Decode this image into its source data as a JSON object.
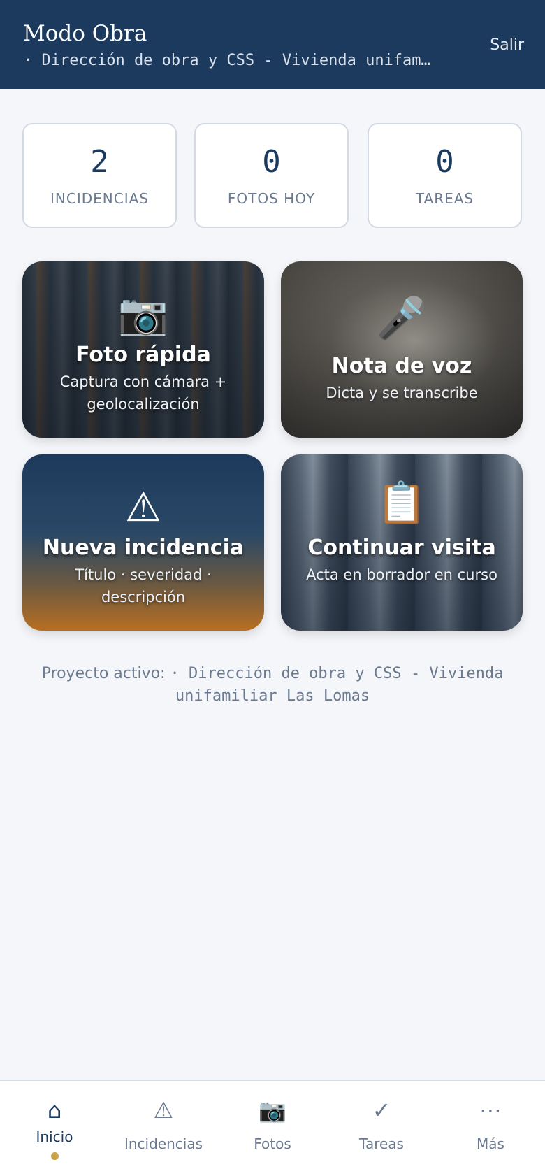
{
  "header": {
    "title": "Modo Obra",
    "subtitle": "· Dirección de obra y CSS - Vivienda unifam…",
    "logout_label": "Salir"
  },
  "stats": [
    {
      "value": "2",
      "label": "INCIDENCIAS"
    },
    {
      "value": "0",
      "label": "FOTOS HOY"
    },
    {
      "value": "0",
      "label": "TAREAS"
    }
  ],
  "actions": [
    {
      "icon": "📷",
      "title": "Foto rápida",
      "subtitle": "Captura con cámara + geolocalización"
    },
    {
      "icon": "🎤",
      "title": "Nota de voz",
      "subtitle": "Dicta y se transcribe"
    },
    {
      "icon": "⚠",
      "title": "Nueva incidencia",
      "subtitle": "Título · severidad · descripción"
    },
    {
      "icon": "📋",
      "title": "Continuar visita",
      "subtitle": "Acta en borrador en curso"
    }
  ],
  "project": {
    "label": "Proyecto activo:",
    "name": "· Dirección de obra y CSS - Vivienda unifamiliar Las Lomas"
  },
  "nav": [
    {
      "icon": "⌂",
      "label": "Inicio",
      "active": true
    },
    {
      "icon": "⚠",
      "label": "Incidencias"
    },
    {
      "icon": "📷",
      "label": "Fotos"
    },
    {
      "icon": "✓",
      "label": "Tareas"
    },
    {
      "icon": "⋯",
      "label": "Más"
    }
  ],
  "colors": {
    "header_bg": "#1c3a5e",
    "page_bg": "#f4f6fa",
    "accent_dot": "#c9a24a",
    "muted_text": "#6b7a8f"
  }
}
